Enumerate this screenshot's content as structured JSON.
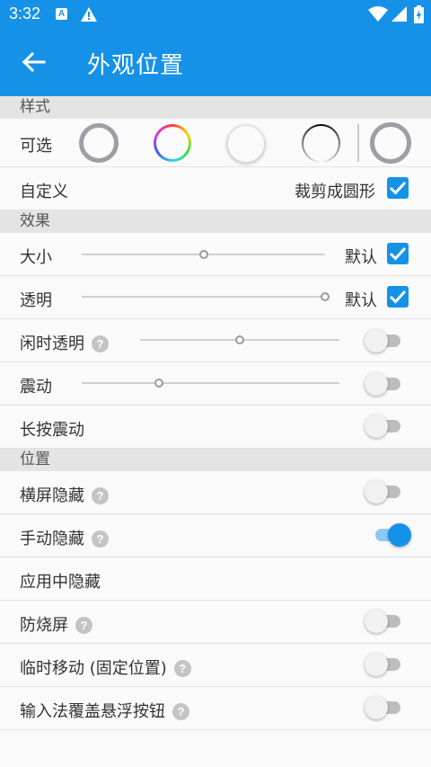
{
  "status_bar": {
    "time": "3:32",
    "icons": [
      "a-icon",
      "warning-icon",
      "wifi-icon",
      "signal-icon",
      "battery-icon"
    ]
  },
  "app_bar": {
    "title": "外观位置",
    "back_icon": "arrow-left-icon"
  },
  "colors": {
    "primary": "#1592e8",
    "section_bg": "#e4e4e4",
    "page_bg": "#fafafa"
  },
  "sections": {
    "style": {
      "header": "样式",
      "optional_label": "可选",
      "custom_label": "自定义",
      "crop_label": "裁剪成圆形",
      "crop_checked": true
    },
    "effects": {
      "header": "效果",
      "size": {
        "label": "大小",
        "slider": 0.5,
        "default_label": "默认",
        "default_checked": true
      },
      "opacity": {
        "label": "透明",
        "slider": 1.0,
        "default_label": "默认",
        "default_checked": true
      },
      "idle_opacity": {
        "label": "闲时透明",
        "slider": 0.5,
        "switch": false
      },
      "vibration": {
        "label": "震动",
        "slider": 0.3,
        "switch": false
      },
      "long_press_vibration": {
        "label": "长按震动",
        "switch": false
      }
    },
    "position": {
      "header": "位置",
      "landscape_hide": {
        "label": "横屏隐藏",
        "switch": false
      },
      "manual_hide": {
        "label": "手动隐藏",
        "switch": true
      },
      "hide_in_apps": {
        "label": "应用中隐藏"
      },
      "burn_in": {
        "label": "防烧屏",
        "switch": false
      },
      "temp_move": {
        "label": "临时移动 (固定位置)",
        "switch": false
      },
      "ime_cover": {
        "label": "输入法覆盖悬浮按钮",
        "switch": false
      }
    }
  },
  "help_glyph": "?"
}
